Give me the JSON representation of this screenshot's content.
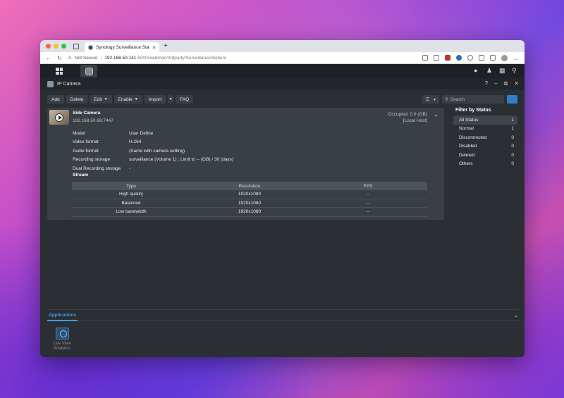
{
  "browser": {
    "tab_title": "Synology Surveillance Station",
    "tab_close": "×",
    "new_tab": "+",
    "not_secure": "Not Secure",
    "url_host": "192.168.50.141",
    "url_path": ":5000/webman/3rdparty/SurveillanceStation/"
  },
  "window": {
    "title": "IP Camera",
    "controls": [
      "?",
      "–",
      "⧉",
      "✕"
    ]
  },
  "toolbar": {
    "add": "Add",
    "delete": "Delete",
    "edit": "Edit",
    "enable": "Enable",
    "import": "Import",
    "faq": "FAQ"
  },
  "search": {
    "placeholder": "Search"
  },
  "camera": {
    "name": "Side Camera",
    "ip": "192.168.50.66:7447",
    "occupied": "Occupied: 0.0 (GB)",
    "host": "[Local Host]",
    "properties": [
      {
        "key": "Model",
        "value": "User Define"
      },
      {
        "key": "Video format",
        "value": "H.264"
      },
      {
        "key": "Audio format",
        "value": "(Same with camera setting)"
      },
      {
        "key": "Recording storage",
        "value": "surveillance (Volume 1) ; Limit to -- (GB) / 30 (days)"
      },
      {
        "key": "Dual Recording storage",
        "value": "-"
      }
    ],
    "stream_title": "Stream",
    "stream_headers": [
      "Type",
      "Resolution",
      "FPS"
    ],
    "streams": [
      {
        "type": "High quality",
        "resolution": "1920x1080",
        "fps": "--"
      },
      {
        "type": "Balanced",
        "resolution": "1920x1080",
        "fps": "--"
      },
      {
        "type": "Low bandwidth",
        "resolution": "1920x1080",
        "fps": "--"
      }
    ]
  },
  "filter": {
    "title": "Filter by Status",
    "items": [
      {
        "label": "All Status",
        "count": "1"
      },
      {
        "label": "Normal",
        "count": "1"
      },
      {
        "label": "Disconnected",
        "count": "0"
      },
      {
        "label": "Disabled",
        "count": "0"
      },
      {
        "label": "Deleted",
        "count": "0"
      },
      {
        "label": "Others",
        "count": "0"
      }
    ]
  },
  "applications": {
    "tab": "Applications",
    "app_label_1": "Live View",
    "app_label_2": "Analytics"
  }
}
